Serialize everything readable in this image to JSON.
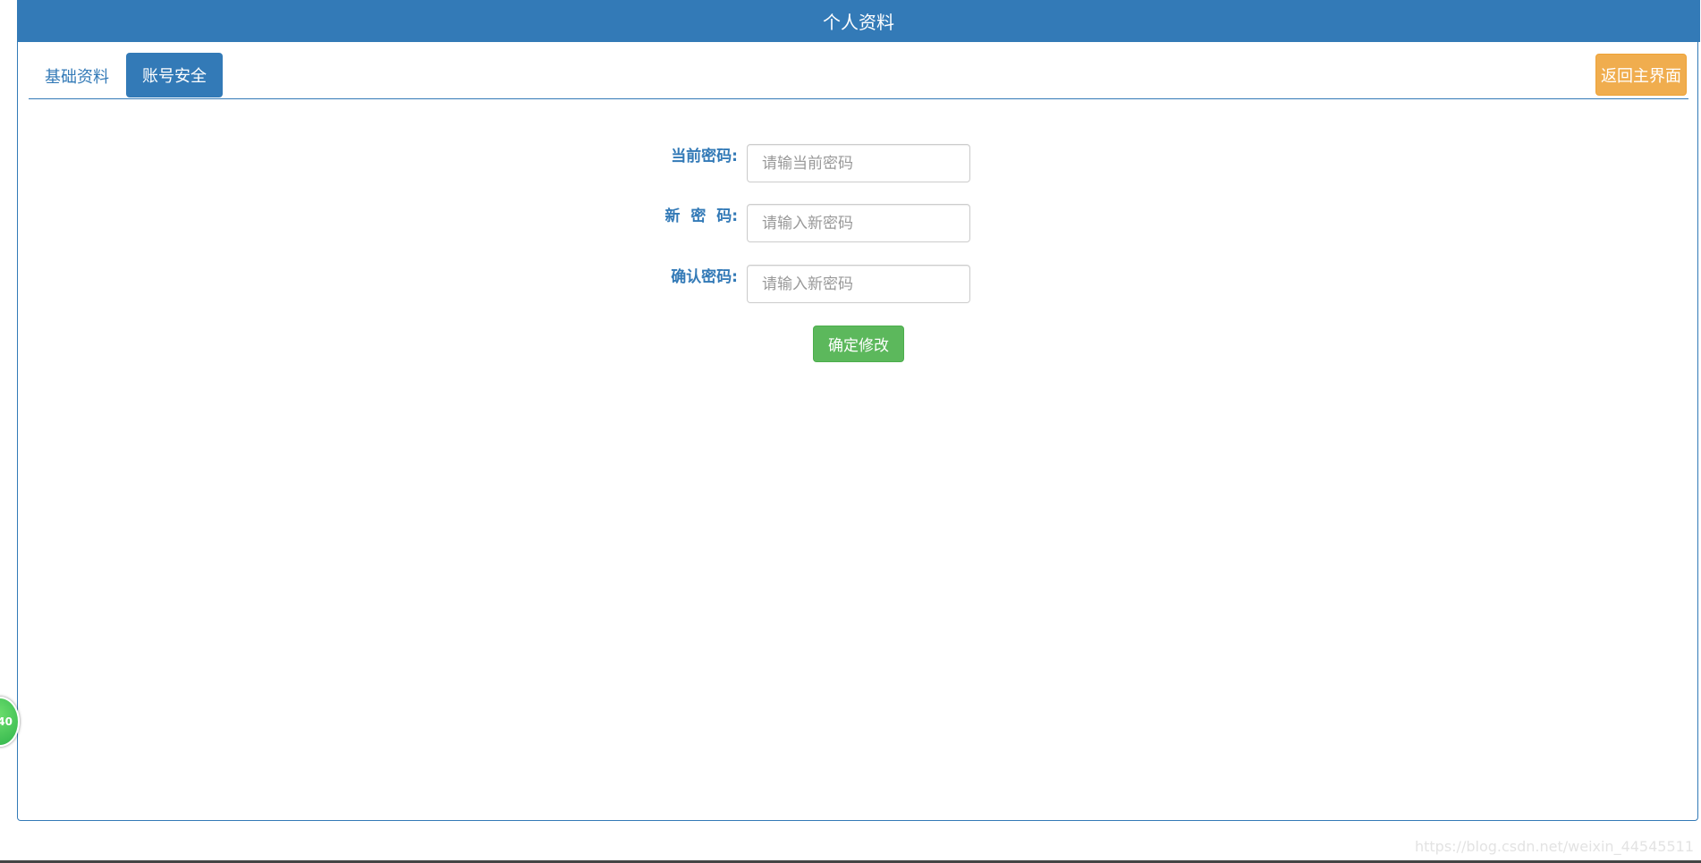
{
  "header": {
    "title": "个人资料"
  },
  "tabs": [
    {
      "label": "基础资料",
      "active": false
    },
    {
      "label": "账号安全",
      "active": true
    }
  ],
  "back_button": {
    "label": "返回主界面"
  },
  "form": {
    "current_password": {
      "label": "当前密码:",
      "placeholder": "请输当前密码",
      "value": ""
    },
    "new_password": {
      "label": "新  密  码:",
      "placeholder": "请输入新密码",
      "value": ""
    },
    "confirm_password": {
      "label": "确认密码:",
      "placeholder": "请输入新密码",
      "value": ""
    },
    "submit_label": "确定修改"
  },
  "float_badge": {
    "text": "40"
  },
  "watermark": "https://blog.csdn.net/weixin_44545511",
  "colors": {
    "primary": "#337ab7",
    "warning": "#f0ad4e",
    "success": "#5cb85c"
  }
}
